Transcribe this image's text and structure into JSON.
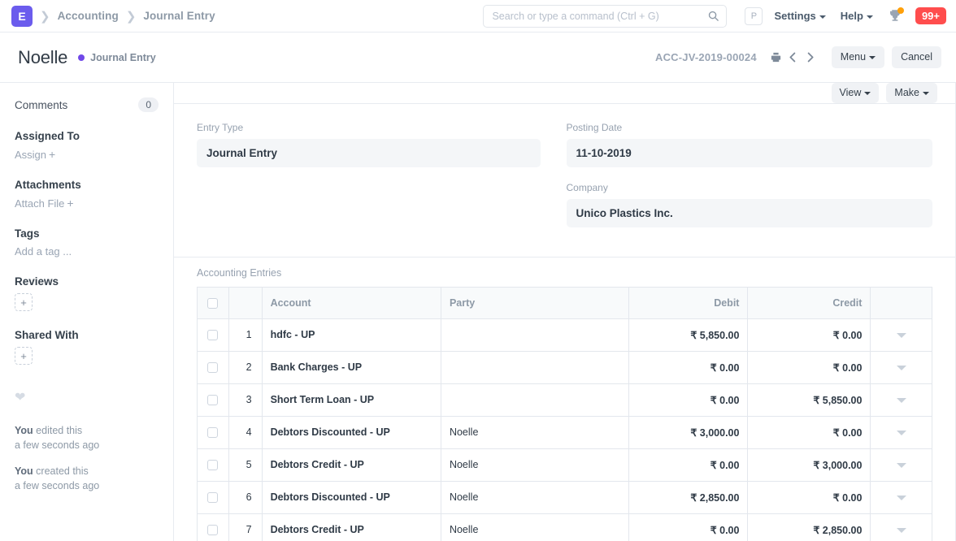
{
  "navbar": {
    "logo_text": "E",
    "breadcrumb": [
      {
        "label": "Accounting"
      },
      {
        "label": "Journal Entry"
      }
    ],
    "search": {
      "placeholder": "Search or type a command (Ctrl + G)",
      "value": "",
      "icon": "search-icon"
    },
    "avatar_initial": "P",
    "settings_label": "Settings",
    "help_label": "Help",
    "trophy_icon": "trophy-icon",
    "notification_badge": "99+",
    "badge_color": "#ff4d4d",
    "logo_color": "#6b5ced"
  },
  "page_head": {
    "title": "Noelle",
    "status_label": "Journal Entry",
    "status_dot_color": "#7048e8",
    "doc_name": "ACC-JV-2019-00024",
    "print_icon": "print-icon",
    "prev_icon": "chevron-left-icon",
    "next_icon": "chevron-right-icon",
    "menu_label": "Menu",
    "cancel_label": "Cancel"
  },
  "sidebar": {
    "comments_label": "Comments",
    "comments_count": "0",
    "assigned_to_label": "Assigned To",
    "assign_label": "Assign",
    "assign_plus": "+",
    "attachments_label": "Attachments",
    "attach_file_label": "Attach File",
    "attach_plus": "+",
    "tags_label": "Tags",
    "add_tag_label": "Add a tag ...",
    "reviews_label": "Reviews",
    "reviews_add": "+",
    "shared_with_label": "Shared With",
    "shared_add": "+",
    "like_icon": "heart-icon",
    "activity": [
      {
        "actor": "You",
        "action": " edited this",
        "time": "a few seconds ago"
      },
      {
        "actor": "You",
        "action": " created this",
        "time": "a few seconds ago"
      }
    ]
  },
  "toolbar": {
    "view_label": "View",
    "make_label": "Make"
  },
  "form": {
    "entry_type_label": "Entry Type",
    "entry_type_value": "Journal Entry",
    "posting_date_label": "Posting Date",
    "posting_date_value": "11-10-2019",
    "company_label": "Company",
    "company_value": "Unico Plastics Inc."
  },
  "entries": {
    "title": "Accounting Entries",
    "columns": [
      "Account",
      "Party",
      "Debit",
      "Credit"
    ],
    "rows": [
      {
        "idx": "1",
        "account": "hdfc - UP",
        "party": "",
        "debit": "₹ 5,850.00",
        "credit": "₹ 0.00"
      },
      {
        "idx": "2",
        "account": "Bank Charges - UP",
        "party": "",
        "debit": "₹ 0.00",
        "credit": "₹ 0.00"
      },
      {
        "idx": "3",
        "account": "Short Term Loan - UP",
        "party": "",
        "debit": "₹ 0.00",
        "credit": "₹ 5,850.00"
      },
      {
        "idx": "4",
        "account": "Debtors Discounted - UP",
        "party": "Noelle",
        "debit": "₹ 3,000.00",
        "credit": "₹ 0.00"
      },
      {
        "idx": "5",
        "account": "Debtors Credit - UP",
        "party": "Noelle",
        "debit": "₹ 0.00",
        "credit": "₹ 3,000.00"
      },
      {
        "idx": "6",
        "account": "Debtors Discounted - UP",
        "party": "Noelle",
        "debit": "₹ 2,850.00",
        "credit": "₹ 0.00"
      },
      {
        "idx": "7",
        "account": "Debtors Credit - UP",
        "party": "Noelle",
        "debit": "₹ 0.00",
        "credit": "₹ 2,850.00"
      }
    ]
  }
}
